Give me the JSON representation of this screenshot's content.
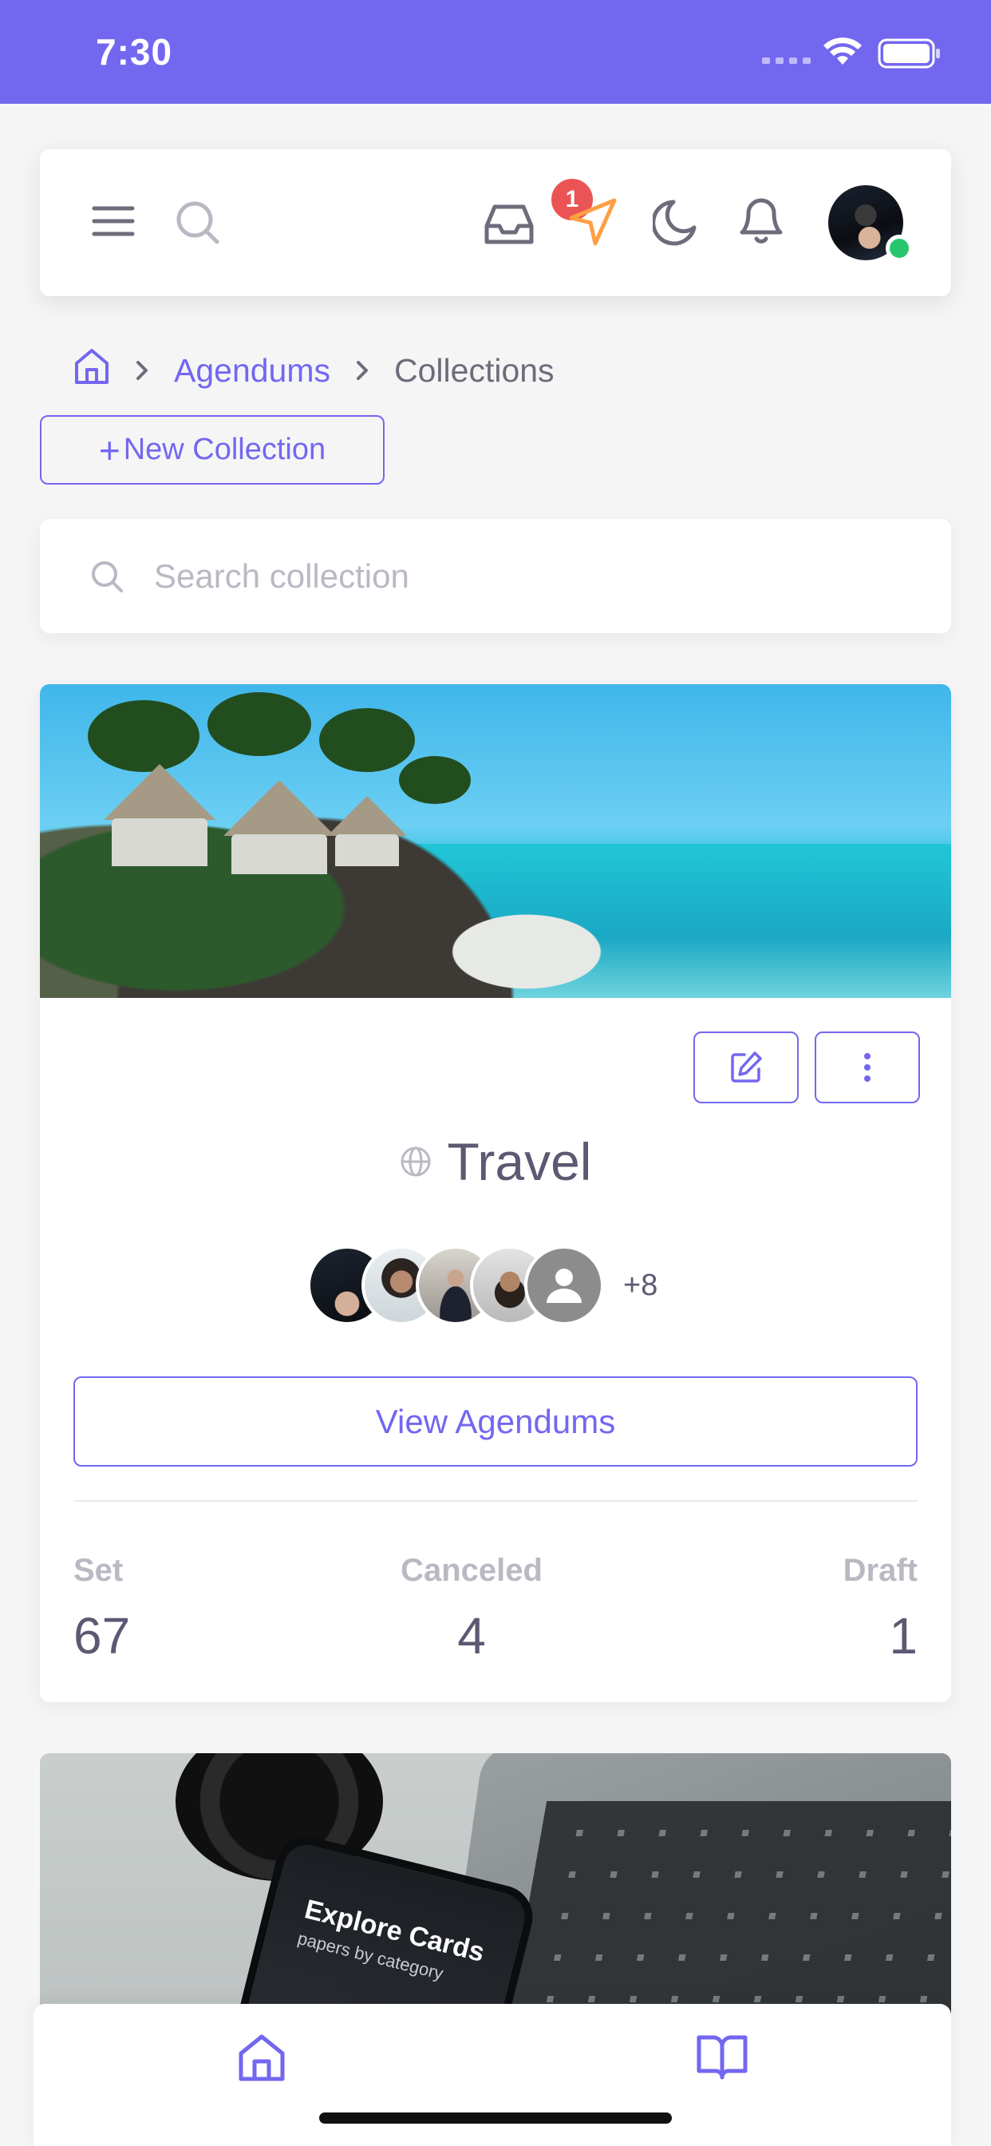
{
  "status_bar": {
    "time": "7:30"
  },
  "header": {
    "inbox_badge": "1",
    "icons": [
      "menu-icon",
      "search-icon",
      "inbox-icon",
      "send-icon",
      "moon-icon",
      "bell-icon"
    ],
    "colors": {
      "accent": "#7367f0",
      "send": "#ff9f43",
      "badge": "#ea5455",
      "online": "#28c76f"
    }
  },
  "breadcrumb": {
    "items": [
      "Agendums",
      "Collections"
    ]
  },
  "actions": {
    "new_collection": "New Collection"
  },
  "search": {
    "placeholder": "Search collection"
  },
  "collection": {
    "title": "Travel",
    "members_more": "+8",
    "view_button": "View Agendums",
    "stats": [
      {
        "label": "Set",
        "value": "67"
      },
      {
        "label": "Canceled",
        "value": "4"
      },
      {
        "label": "Draft",
        "value": "1"
      }
    ]
  },
  "next_card": {
    "phone_title": "Explore Cards",
    "phone_subtitle": "papers by category"
  },
  "bottom_nav": {
    "items": [
      "home-icon",
      "book-icon"
    ]
  }
}
